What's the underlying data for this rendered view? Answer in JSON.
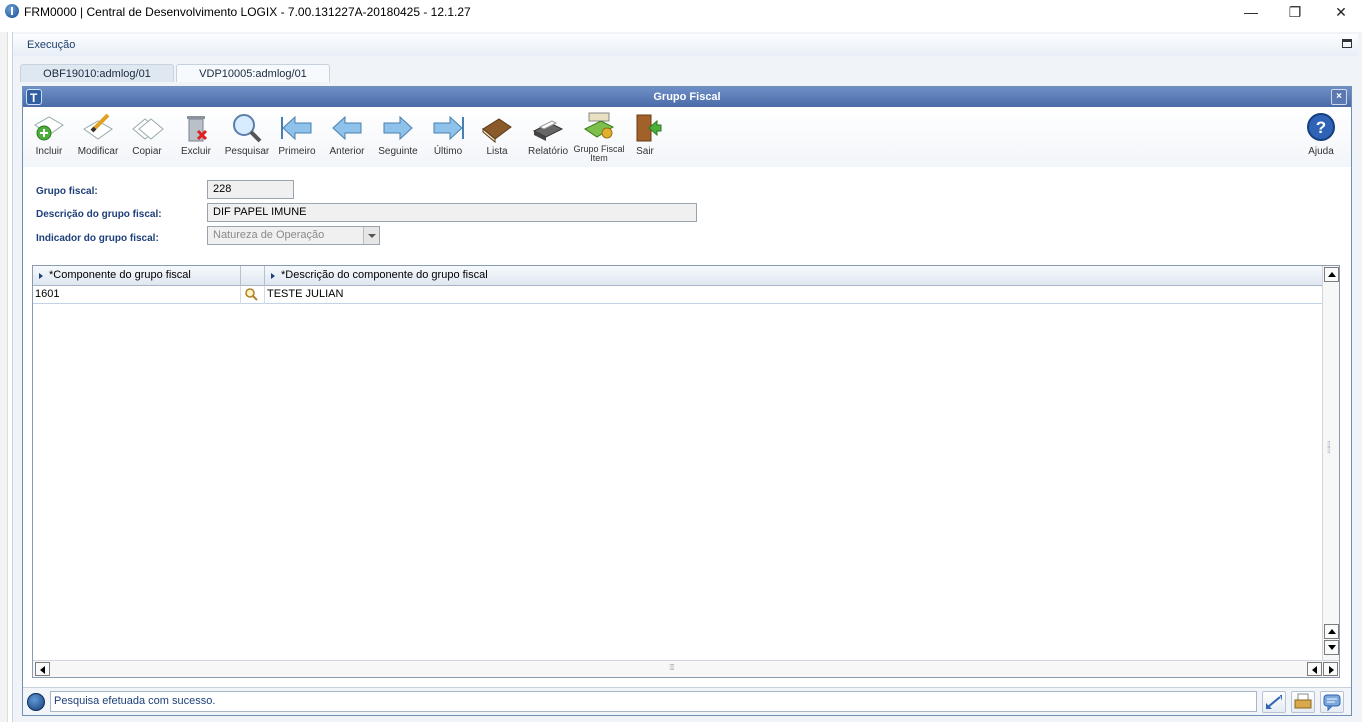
{
  "window": {
    "title": "FRM0000 | Central de Desenvolvimento LOGIX  -  7.00.131227A-20180425  -  12.1.27",
    "controls": {
      "minimize": "—",
      "restore": "❐",
      "close": "✕"
    }
  },
  "menu": {
    "execucao": "Execução"
  },
  "tabs": [
    {
      "label": "OBF19010:admlog/01",
      "active": false
    },
    {
      "label": "VDP10005:admlog/01",
      "active": true
    }
  ],
  "frame": {
    "title": "Grupo Fiscal",
    "close": "×"
  },
  "toolbar": {
    "incluir": "Incluir",
    "modificar": "Modificar",
    "copiar": "Copiar",
    "excluir": "Excluir",
    "pesquisar": "Pesquisar",
    "primeiro": "Primeiro",
    "anterior": "Anterior",
    "seguinte": "Seguinte",
    "ultimo": "Último",
    "lista": "Lista",
    "relatorio": "Relatório",
    "grupo_fiscal_item_1": "Grupo Fiscal",
    "grupo_fiscal_item_2": "Item",
    "sair": "Sair",
    "ajuda": "Ajuda"
  },
  "form": {
    "grupo_fiscal_label": "Grupo fiscal:",
    "grupo_fiscal_value": "228",
    "descricao_label": "Descrição do grupo fiscal:",
    "descricao_value": "DIF PAPEL IMUNE",
    "indicador_label": "Indicador do grupo fiscal:",
    "indicador_value": "Natureza de Operação"
  },
  "grid": {
    "columns": [
      "*Componente do grupo fiscal",
      "*Descrição do componente do grupo fiscal"
    ],
    "rows": [
      {
        "componente": "1601",
        "descricao": "TESTE JULIAN"
      }
    ]
  },
  "status": {
    "message": "Pesquisa efetuada com sucesso."
  }
}
